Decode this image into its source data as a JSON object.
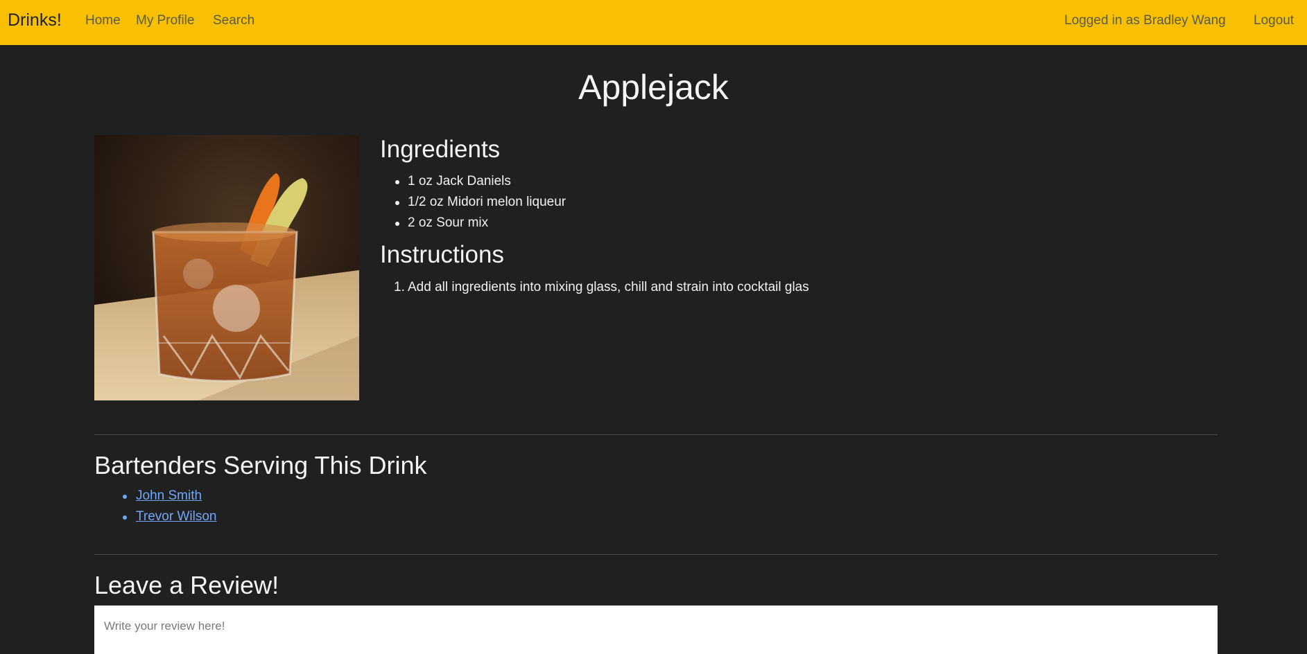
{
  "nav": {
    "brand": "Drinks!",
    "links": [
      "Home",
      "My Profile",
      "Search"
    ],
    "user_text": "Logged in as Bradley Wang",
    "logout": "Logout",
    "bg_color": "#f8c000"
  },
  "drink": {
    "name": "Applejack",
    "ingredients_heading": "Ingredients",
    "ingredients": [
      "1 oz Jack Daniels",
      "1/2 oz Midori melon liqueur",
      "2 oz Sour mix"
    ],
    "instructions_heading": "Instructions",
    "instructions": [
      "Add all ingredients into mixing glass, chill and strain into cocktail glas"
    ],
    "instruction_numbers": [
      "1."
    ]
  },
  "bartenders": {
    "heading": "Bartenders Serving This Drink",
    "names": [
      "John Smith",
      "Trevor Wilson"
    ]
  },
  "review": {
    "heading": "Leave a Review!",
    "placeholder": "Write your review here!"
  }
}
